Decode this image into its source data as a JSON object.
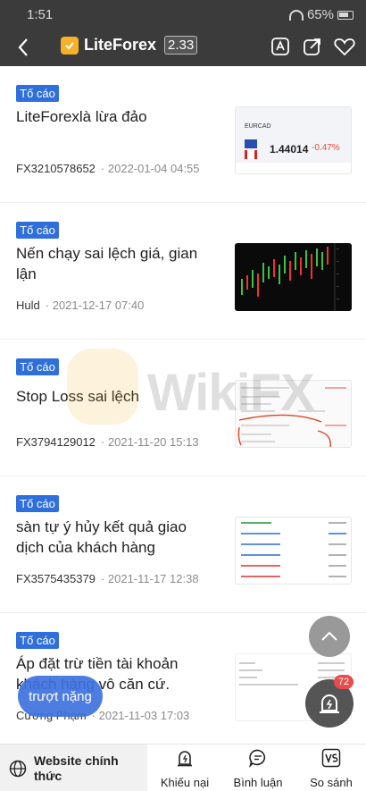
{
  "status_bar": {
    "time": "1:51",
    "battery": "65%"
  },
  "header": {
    "brand": "LiteForex",
    "score": "2.33"
  },
  "items": [
    {
      "tag": "Tố cáo",
      "title": "LiteForexlà lừa đảo",
      "author": "FX3210578652",
      "date": "2022-01-04 04:55",
      "thumb": {
        "pair": "EURCAD",
        "price": "1.44014",
        "change": "-0.47%"
      }
    },
    {
      "tag": "Tố cáo",
      "title": "Nến chạy sai lệch giá, gian lận",
      "author": "Huld",
      "date": "2021-12-17 07:40"
    },
    {
      "tag": "Tố cáo",
      "title": "Stop Loss sai lệch",
      "author": "FX3794129012",
      "date": "2021-11-20 15:13"
    },
    {
      "tag": "Tố cáo",
      "title": "sàn tự ý hủy kết quả giao dịch của khách hàng",
      "author": "FX3575435379",
      "date": "2021-11-17 12:38"
    },
    {
      "tag": "Tố cáo",
      "title": "Áp đặt trừ tiền tài khoản khách hàng vô căn cứ.",
      "author": "Cường Phạm",
      "date": "2021-11-03 17:03"
    }
  ],
  "watermark": "WikiFX",
  "floating": {
    "pill_label": "trượt nặng",
    "badge_count": "72"
  },
  "bottom_nav": {
    "website_label": "Website chính thức",
    "complaint_label": "Khiếu nại",
    "comment_label": "Bình luận",
    "compare_label": "So sánh"
  },
  "colors": {
    "header_bg": "#3b3b3b",
    "tag_blue": "#2f6fdc",
    "badge_red": "#e84b4b",
    "brand_gold": "#f3b22a"
  }
}
